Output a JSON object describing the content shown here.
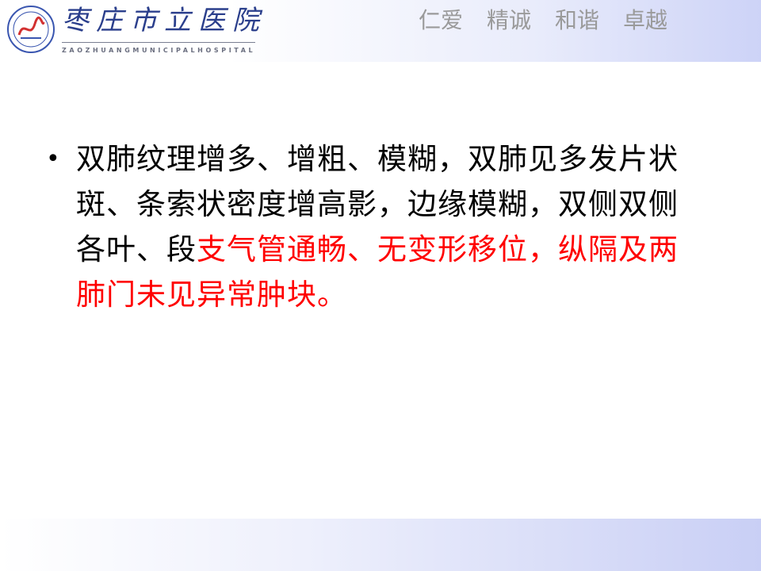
{
  "header": {
    "hospital_name": "枣庄市立医院",
    "hospital_name_en": "ZAOZHUANGMUNICIPALHOSPITAL",
    "motto": [
      "仁爱",
      "精诚",
      "和谐",
      "卓越"
    ],
    "logo_icon": "hospital-emblem-icon"
  },
  "content": {
    "bullet": "•",
    "text_black": "双肺纹理增多、增粗、模糊，双肺见多发片状斑、条索状密度增高影，边缘模糊，双侧双侧各叶、段",
    "text_red": "支气管通畅、无变形移位，纵隔及两肺门未见异常肿块。"
  },
  "colors": {
    "hospital_blue": "#2b3f8c",
    "motto_gray": "#9a9a9a",
    "highlight_red": "#ff0000",
    "band_blue": "#c9cff5"
  }
}
